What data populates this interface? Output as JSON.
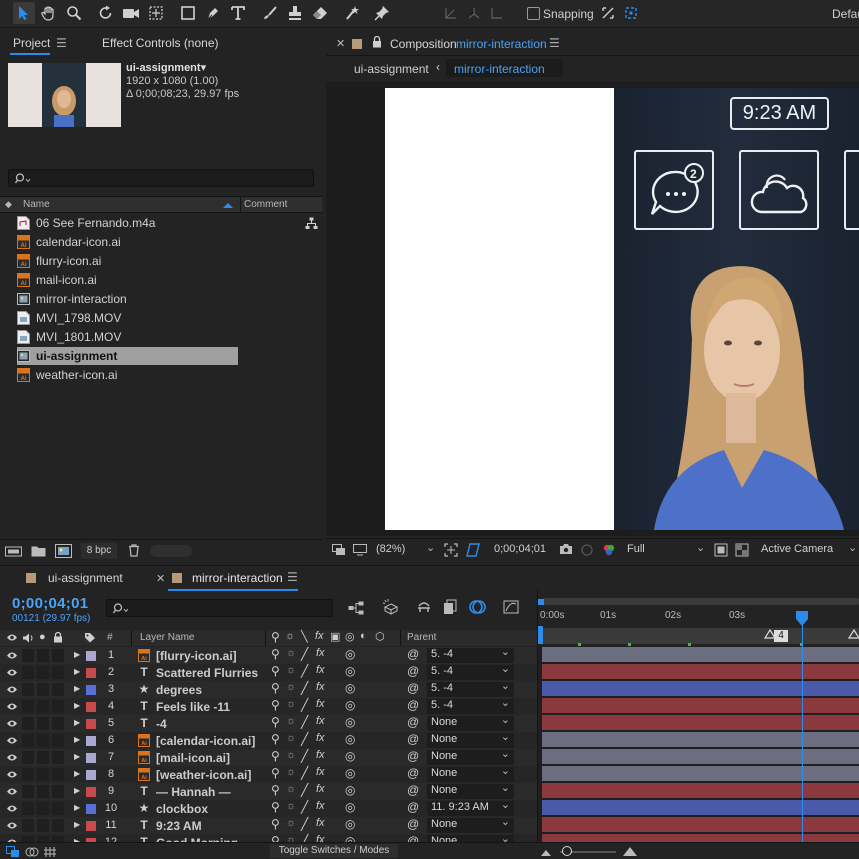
{
  "toolbar": {
    "snapping_label": "Snapping",
    "workspace_label": "Default"
  },
  "project_panel": {
    "tab_project": "Project",
    "tab_effect_controls": "Effect Controls (none)",
    "selected_item": {
      "name": "ui-assignment▾",
      "resolution": "1920 x 1080 (1.00)",
      "duration": "Δ 0;00;08;23, 29.97 fps"
    },
    "columns": {
      "name": "Name",
      "comment": "Comment"
    },
    "items": [
      {
        "label": "06 See Fernando.m4a",
        "icon": "audio-file-icon",
        "color": "#c8c8c8"
      },
      {
        "label": "calendar-icon.ai",
        "icon": "illustrator-file-icon",
        "color": "#d9731d"
      },
      {
        "label": "flurry-icon.ai",
        "icon": "illustrator-file-icon",
        "color": "#d9731d"
      },
      {
        "label": "mail-icon.ai",
        "icon": "illustrator-file-icon",
        "color": "#d9731d"
      },
      {
        "label": "mirror-interaction",
        "icon": "composition-icon",
        "color": "#8aa4c0"
      },
      {
        "label": "MVI_1798.MOV",
        "icon": "video-file-icon",
        "color": "#8aa4c0"
      },
      {
        "label": "MVI_1801.MOV",
        "icon": "video-file-icon",
        "color": "#8aa4c0"
      },
      {
        "label": "ui-assignment",
        "icon": "composition-icon",
        "color": "#8aa4c0",
        "selected": true
      },
      {
        "label": "weather-icon.ai",
        "icon": "illustrator-file-icon",
        "color": "#d9731d"
      }
    ],
    "bit_depth": "8 bpc"
  },
  "composition_panel": {
    "title_prefix": "Composition",
    "title_name": "mirror-interaction",
    "breadcrumb_parent": "ui-assignment",
    "breadcrumb_current": "mirror-interaction",
    "mirror_ui": {
      "clock_text": "9:23 AM",
      "notification_count": "2"
    },
    "footer": {
      "zoom": "(82%)",
      "timecode": "0;00;04;01",
      "resolution": "Full",
      "camera": "Active Camera"
    }
  },
  "timeline": {
    "tabs": [
      "ui-assignment",
      "mirror-interaction"
    ],
    "active_tab": "mirror-interaction",
    "current_time": "0;00;04;01",
    "frame_info": "00121 (29.97 fps)",
    "ruler_labels": [
      "0:00s",
      "01s",
      "02s",
      "03s"
    ],
    "marker_label": "4",
    "columns": {
      "num": "#",
      "layer_name": "Layer Name",
      "parent": "Parent"
    },
    "toggle_label": "Toggle Switches / Modes",
    "layers": [
      {
        "num": "1",
        "type": "ai",
        "name": "[flurry-icon.ai]",
        "parent": "5. -4",
        "label_color": "#a9a9d0",
        "bar_color": "#6d6d80"
      },
      {
        "num": "2",
        "type": "T",
        "name": "Scattered Flurries",
        "parent": "5. -4",
        "label_color": "#c84a4a",
        "bar_color": "#8a3a3e"
      },
      {
        "num": "3",
        "type": "★",
        "name": "degrees",
        "parent": "5. -4",
        "label_color": "#5a6fd6",
        "bar_color": "#4a5aa8"
      },
      {
        "num": "4",
        "type": "T",
        "name": "Feels like -11",
        "parent": "5. -4",
        "label_color": "#c84a4a",
        "bar_color": "#8a3a3e"
      },
      {
        "num": "5",
        "type": "T",
        "name": "-4",
        "parent": "None",
        "label_color": "#c84a4a",
        "bar_color": "#8a3a3e"
      },
      {
        "num": "6",
        "type": "ai",
        "name": "[calendar-icon.ai]",
        "parent": "None",
        "label_color": "#a9a9d0",
        "bar_color": "#6d6d80"
      },
      {
        "num": "7",
        "type": "ai",
        "name": "[mail-icon.ai]",
        "parent": "None",
        "label_color": "#a9a9d0",
        "bar_color": "#6d6d80"
      },
      {
        "num": "8",
        "type": "ai",
        "name": "[weather-icon.ai]",
        "parent": "None",
        "label_color": "#a9a9d0",
        "bar_color": "#6d6d80"
      },
      {
        "num": "9",
        "type": "T",
        "name": "— Hannah —",
        "parent": "None",
        "label_color": "#c84a4a",
        "bar_color": "#8a3a3e"
      },
      {
        "num": "10",
        "type": "★",
        "name": "clockbox",
        "parent": "11. 9:23 AM",
        "label_color": "#5a6fd6",
        "bar_color": "#4a5aa8"
      },
      {
        "num": "11",
        "type": "T",
        "name": "9:23 AM",
        "parent": "None",
        "label_color": "#c84a4a",
        "bar_color": "#8a3a3e"
      },
      {
        "num": "12",
        "type": "T",
        "name": "Good Morning",
        "parent": "None",
        "label_color": "#c84a4a",
        "bar_color": "#8a3a3e"
      }
    ]
  },
  "colors": {
    "accent_blue": "#2d8ceb",
    "timecode_blue": "#4ba3f5",
    "panel_bg": "#232323"
  }
}
